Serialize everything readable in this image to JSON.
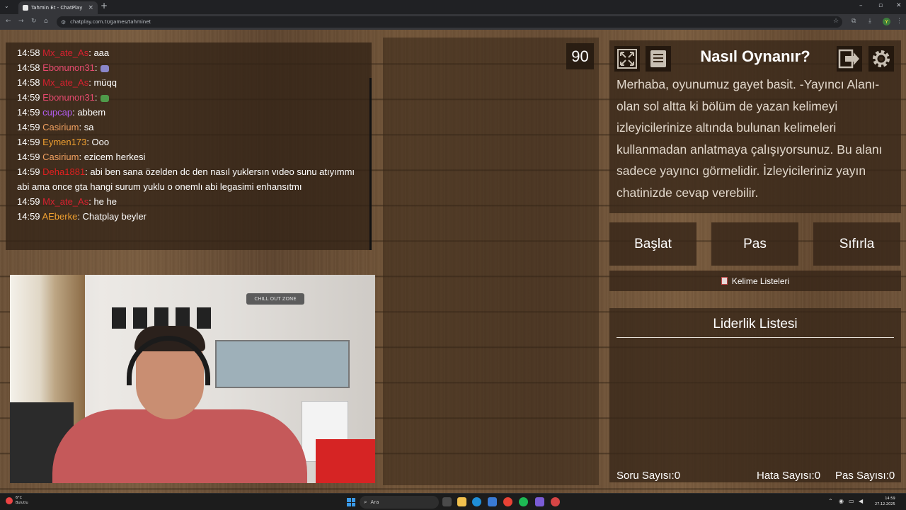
{
  "browser": {
    "tab_title": "Tahmin Et - ChatPlay",
    "url": "chatplay.com.tr/games/tahminet",
    "profile_initial": "Y"
  },
  "chat": {
    "messages": [
      {
        "time": "14:58",
        "user": "Mx_ate_As",
        "user_color": "#d8202f",
        "text": ": aaa"
      },
      {
        "time": "14:58",
        "user": "Ebonunon31",
        "user_color": "#e64a6f",
        "text": ":"
      },
      {
        "time": "14:58",
        "user": "Mx_ate_As",
        "user_color": "#d8202f",
        "text": ": müqq"
      },
      {
        "time": "14:59",
        "user": "Ebonunon31",
        "user_color": "#e64a6f",
        "text": ":"
      },
      {
        "time": "14:59",
        "user": "cupcap",
        "user_color": "#b15cf0",
        "text": ": abbem"
      },
      {
        "time": "14:59",
        "user": "Casirium",
        "user_color": "#f0a060",
        "text": ": sa"
      },
      {
        "time": "14:59",
        "user": "Eymen173",
        "user_color": "#f0a030",
        "text": ": Ooo"
      },
      {
        "time": "14:59",
        "user": "Casirium",
        "user_color": "#f0a060",
        "text": ": ezicem herkesi"
      },
      {
        "time": "14:59",
        "user": "Deha1881",
        "user_color": "#e02020",
        "text": ": abi ben sana özelden dc den nasıl yuklersın vıdeo sunu atıyımmı abi ama once gta hangi surum yuklu o onemlı abi legasimi enhansıtmı"
      },
      {
        "time": "14:59",
        "user": "Mx_ate_As",
        "user_color": "#d8202f",
        "text": ": he he"
      },
      {
        "time": "14:59",
        "user": "AEberke",
        "user_color": "#f0a030",
        "text": ": Chatplay beyler"
      }
    ]
  },
  "webcam": {
    "sign_text": "CHILL OUT ZONE"
  },
  "timer": "90",
  "howto": {
    "title": "Nasıl Oynanır?",
    "text": "Merhaba, oyunumuz gayet basit. -Yayıncı Alanı- olan sol altta ki bölüm de yazan kelimeyi izleyicilerinize altında bulunan kelimeleri kullanmadan anlatmaya çalışıyorsunuz. Bu alanı sadece yayıncı görmelidir. İzleyicileriniz yayın chatinizde cevap verebilir."
  },
  "actions": {
    "start": "Başlat",
    "pass": "Pas",
    "reset": "Sıfırla",
    "word_lists": "Kelime Listeleri"
  },
  "leaderboard": {
    "title": "Liderlik Listesi",
    "question_count": "Soru Sayısı:0",
    "error_count": "Hata Sayısı:0",
    "pass_count": "Pas Sayısı:0"
  },
  "taskbar": {
    "weather_temp": "6°C",
    "weather_desc": "Bulutlu",
    "search_placeholder": "Ara",
    "time": "14:59",
    "date": "27.12.2025"
  },
  "icons": {
    "fullscreen": "fullscreen-icon",
    "document": "document-icon",
    "exit": "exit-icon",
    "settings": "gear-icon"
  }
}
